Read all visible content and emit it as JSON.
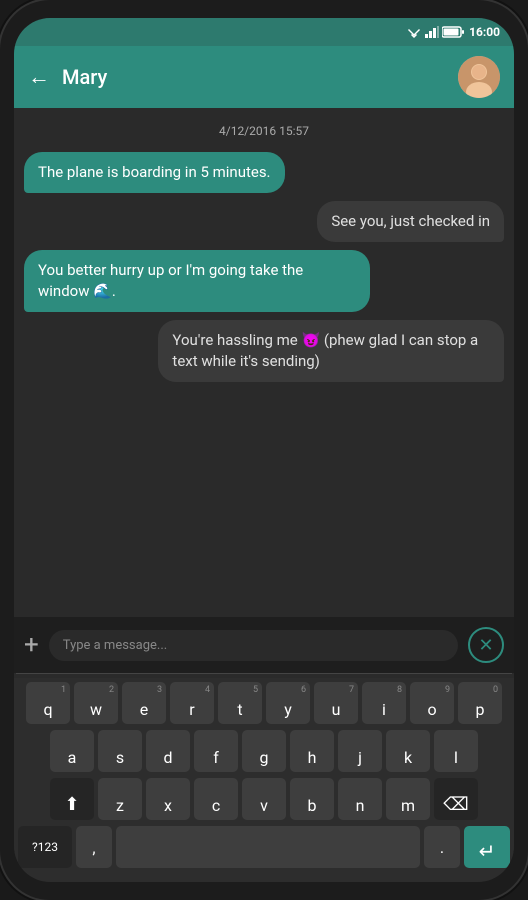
{
  "statusBar": {
    "time": "16:00"
  },
  "header": {
    "backLabel": "←",
    "contactName": "Mary"
  },
  "chat": {
    "dateLabel": "4/12/2016 15:57",
    "messages": [
      {
        "id": 1,
        "type": "sent",
        "text": "The plane is boarding in 5 minutes."
      },
      {
        "id": 2,
        "type": "received",
        "text": "See you, just checked in"
      },
      {
        "id": 3,
        "type": "sent",
        "text": "You better hurry up or I'm going take the window 🌊."
      },
      {
        "id": 4,
        "type": "received",
        "text": "You're hassling me 😈 (phew glad I can stop a text while it's sending)"
      }
    ]
  },
  "inputArea": {
    "plusLabel": "+",
    "messageText": "",
    "cancelLabel": "✕"
  },
  "keyboard": {
    "rows": [
      [
        "q",
        "w",
        "e",
        "r",
        "t",
        "y",
        "u",
        "i",
        "o",
        "p"
      ],
      [
        "a",
        "s",
        "d",
        "f",
        "g",
        "h",
        "j",
        "k",
        "l"
      ],
      [
        "z",
        "x",
        "c",
        "v",
        "b",
        "n",
        "m"
      ]
    ],
    "nums": [
      "1",
      "2",
      "3",
      "4",
      "5",
      "6",
      "7",
      "8",
      "9",
      "0"
    ],
    "specialKeys": {
      "shift": "⬆",
      "backspace": "⌫",
      "nums": "?123",
      "comma": ",",
      "space": "",
      "period": ".",
      "enter": "↵"
    }
  }
}
